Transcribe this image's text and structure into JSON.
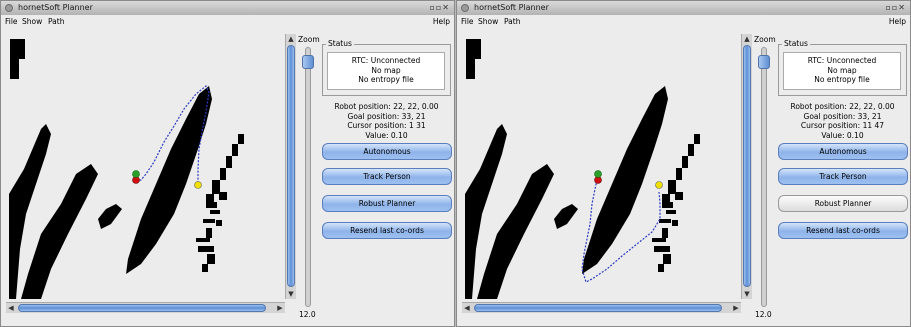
{
  "colors": {
    "accent": "#6f9be0",
    "path": "#2a3bc4",
    "start_marker": "#d01010",
    "robot_marker": "#2aa02a",
    "goal_marker": "#f0e000",
    "obstacle": "#000000"
  },
  "windows": [
    {
      "title": "hornetSoft Planner",
      "menu": {
        "file": "File",
        "show": "Show",
        "path": "Path",
        "help": "Help"
      },
      "zoom": {
        "label": "Zoom",
        "value": "12.0"
      },
      "status": {
        "legend": "Status",
        "rtc": "RTC: Unconnected",
        "map": "No map",
        "entropy": "No entropy file"
      },
      "info": {
        "robot_position": "Robot position: 22, 22, 0.00",
        "goal_position": "Goal position: 33, 21",
        "cursor_position": "Cursor position:   1  31",
        "value": "Value: 0.10"
      },
      "buttons": {
        "autonomous": "Autonomous",
        "track_person": "Track Person",
        "robust_planner": "Robust Planner",
        "resend": "Resend last co-ords"
      },
      "robust_planner_active": true
    },
    {
      "title": "hornetSoft Planner",
      "menu": {
        "file": "File",
        "show": "Show",
        "path": "Path",
        "help": "Help"
      },
      "zoom": {
        "label": "Zoom",
        "value": "12.0"
      },
      "status": {
        "legend": "Status",
        "rtc": "RTC: Unconnected",
        "map": "No map",
        "entropy": "No entropy file"
      },
      "info": {
        "robot_position": "Robot position: 22, 22, 0.00",
        "goal_position": "Goal position: 33, 21",
        "cursor_position": "Cursor position:  11  47",
        "value": "Value: 0.10"
      },
      "buttons": {
        "autonomous": "Autonomous",
        "track_person": "Track Person",
        "robust_planner": "Robust Planner",
        "resend": "Resend last co-ords"
      },
      "robust_planner_active": false
    }
  ]
}
